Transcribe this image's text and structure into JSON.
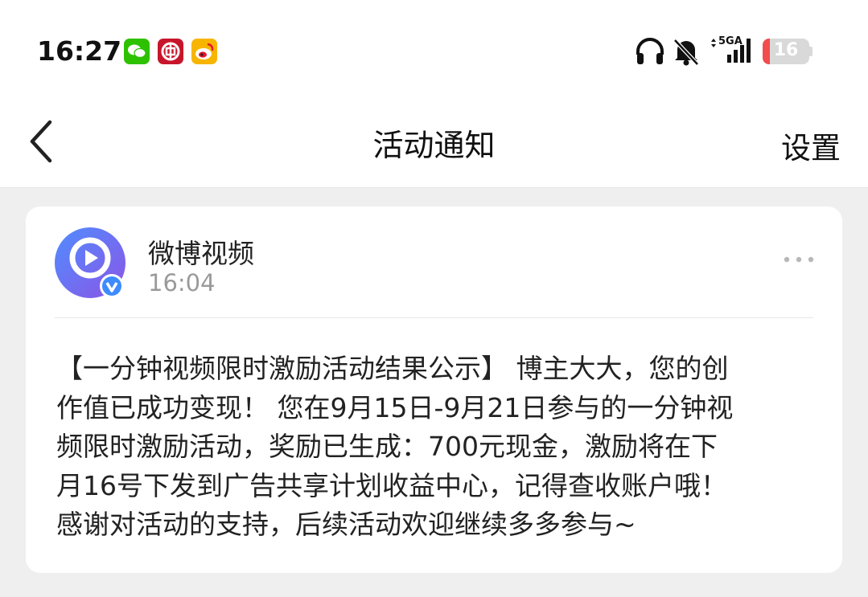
{
  "status_bar": {
    "time": "16:27",
    "network": "5GA",
    "battery_level": "16",
    "battery_fraction": 0.16,
    "notification_icons": [
      "wechat-icon",
      "bank-app-icon",
      "weibo-icon"
    ],
    "system_icons": [
      "headphones-icon",
      "mute-bell-icon",
      "signal-icon",
      "battery-icon"
    ]
  },
  "nav": {
    "title": "活动通知",
    "settings_label": "设置",
    "back_icon": "chevron-left-icon"
  },
  "card": {
    "sender": "微博视频",
    "time": "16:04",
    "message_lines": [
      "【一分钟视频限时激励活动结果公示】 博主大大，您的创",
      "作值已成功变现！ 您在9月15日-9月21日参与的一分钟视",
      "频限时激励活动，奖励已生成：700元现金，激励将在下",
      "月16号下发到广告共享计划收益中心，记得查收账户哦！",
      "感谢对活动的支持，后续活动欢迎继续多多参与~"
    ]
  },
  "colors": {
    "background": "#efefef",
    "card": "#ffffff",
    "accent_blue": "#3d8bff",
    "avatar_purple": "#6b6fe8",
    "battery_red": "#f24c4c",
    "muted_text": "#9a9a9a"
  }
}
